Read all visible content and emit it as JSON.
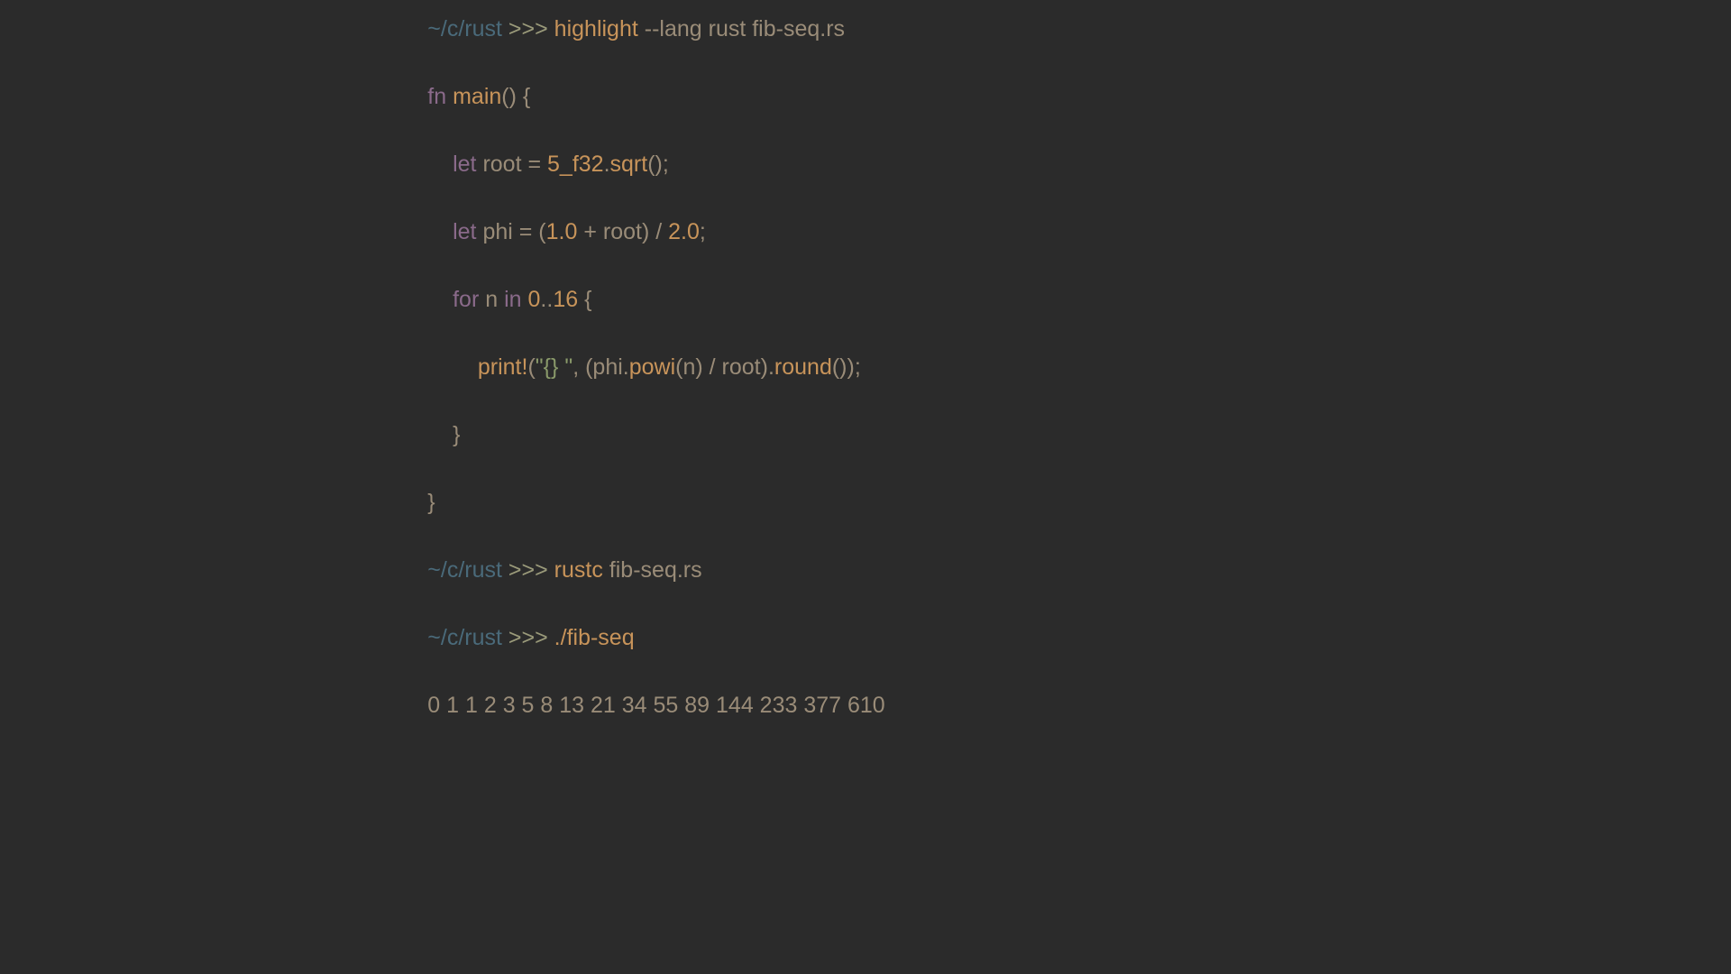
{
  "prompt": {
    "path": "~/c/rust",
    "symbol": " >>> "
  },
  "lines": {
    "cmd1_cmd": "highlight",
    "cmd1_args": " --lang rust fib-seq.rs",
    "cmd2_cmd": "rustc",
    "cmd2_args": " fib-seq.rs",
    "cmd3_cmd": "./fib-seq",
    "output": "0 1 1 2 3 5 8 13 21 34 55 89 144 233 377 610"
  },
  "code": {
    "l1_fn": "fn",
    "l1_sp1": " ",
    "l1_main": "main",
    "l1_rest": "() {",
    "l2_indent": "    ",
    "l2_let": "let",
    "l2_mid": " root = ",
    "l2_num": "5_f32",
    "l2_dot": ".",
    "l2_sqrt": "sqrt",
    "l2_end": "();",
    "l3_indent": "    ",
    "l3_let": "let",
    "l3_mid": " phi = (",
    "l3_n1": "1.0",
    "l3_plus": " + root) / ",
    "l3_n2": "2.0",
    "l3_end": ";",
    "l4_indent": "    ",
    "l4_for": "for",
    "l4_sp1": " n ",
    "l4_in": "in",
    "l4_sp2": " ",
    "l4_r1": "0",
    "l4_dots": "..",
    "l4_r2": "16",
    "l4_end": " {",
    "l5_indent": "        ",
    "l5_print": "print!",
    "l5_p1": "(",
    "l5_str": "\"{} \"",
    "l5_mid": ", (phi.",
    "l5_powi": "powi",
    "l5_mid2": "(n) / root).",
    "l5_round": "round",
    "l5_end": "());",
    "l6": "    }",
    "l7": "}"
  }
}
